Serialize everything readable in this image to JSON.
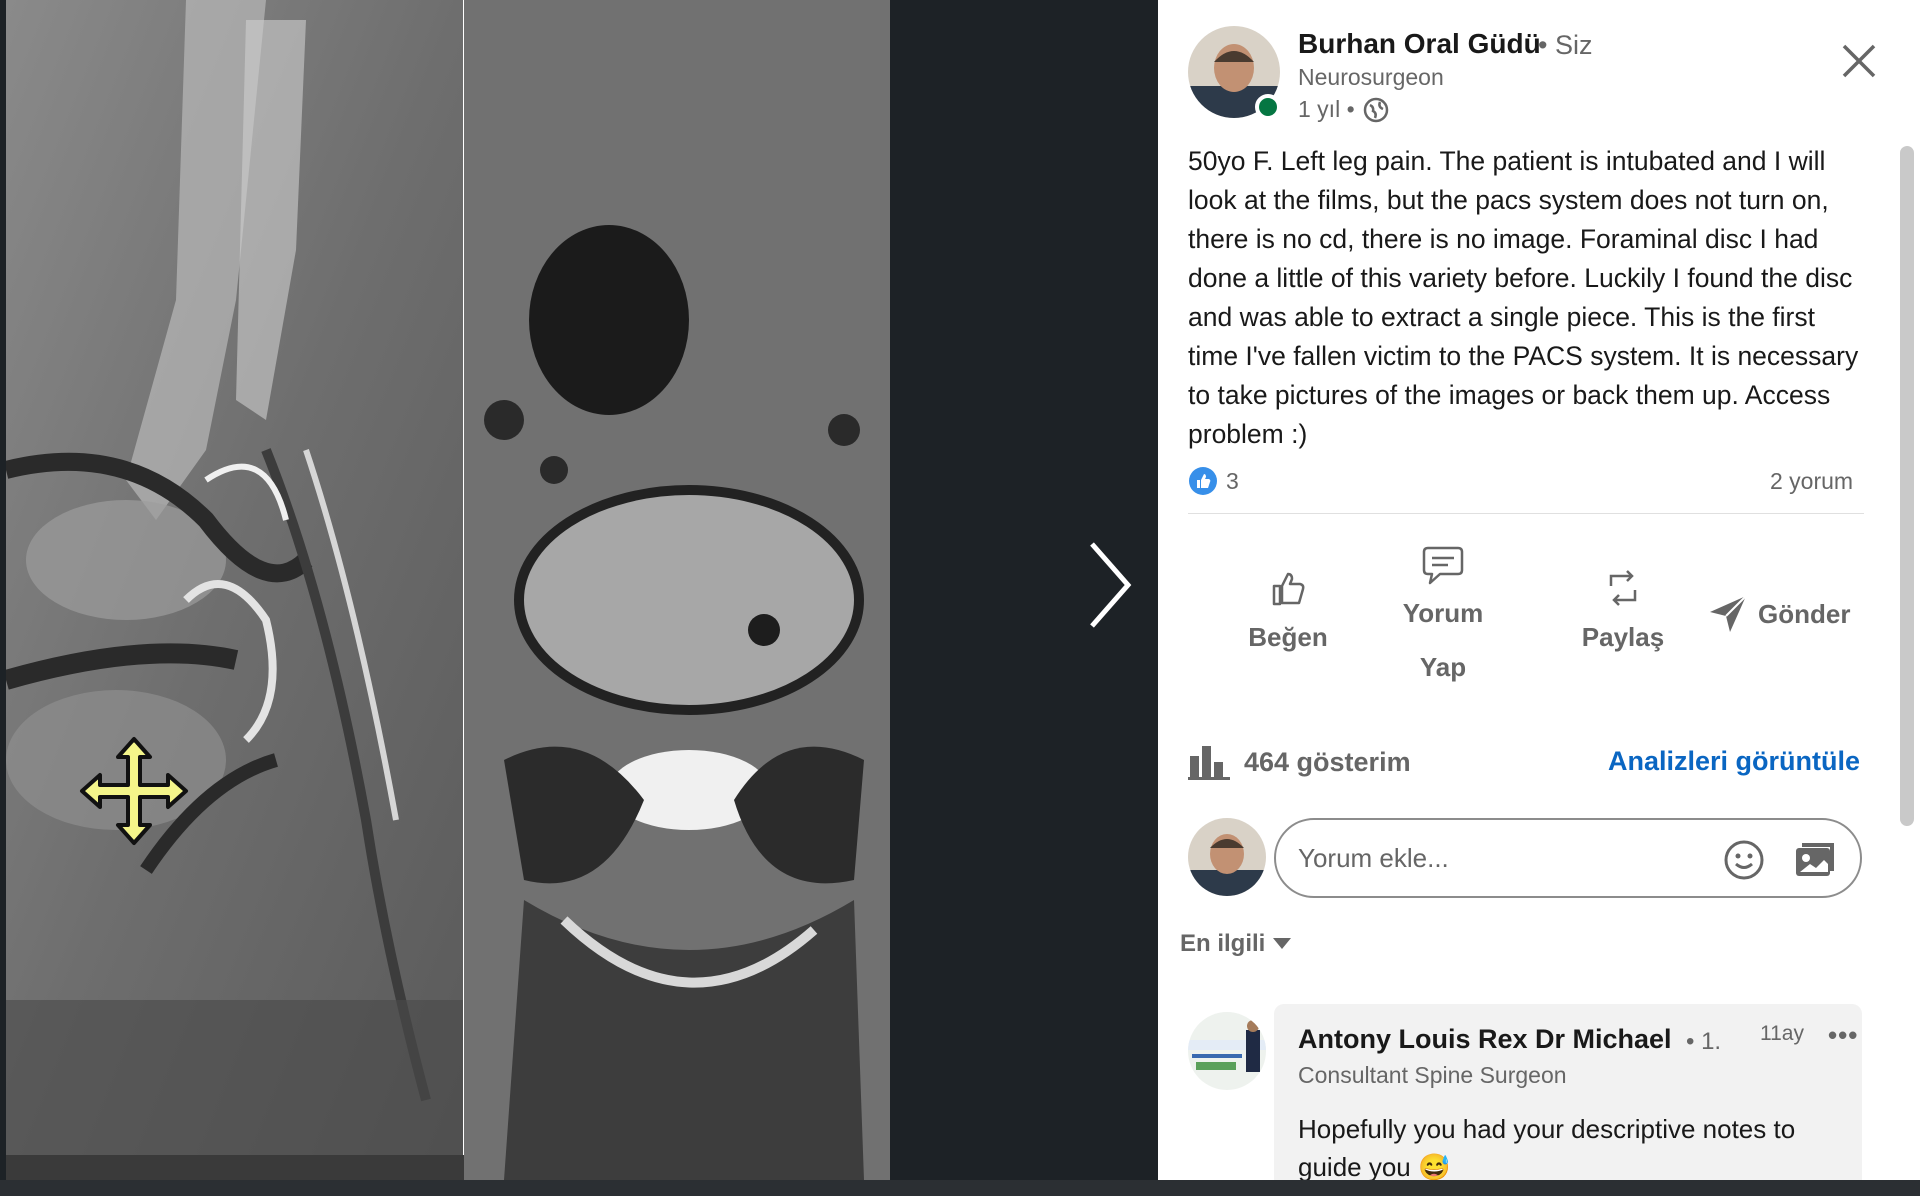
{
  "post": {
    "author_name": "Burhan Oral Güdü",
    "author_you": "• Siz",
    "author_title": "Neurosurgeon",
    "time": "1 yıl •",
    "text": "50yo F. Left leg pain. The patient is intubated and I will look at the films, but the pacs system does not turn on, there is no cd, there is no image. Foraminal disc I had done a little of this variety before. Luckily I found the disc and was able to extract a single piece. This is the first time I've fallen victim to the PACS system. It is necessary to take pictures of the images or back them up. Access problem :)",
    "reaction_count": "3",
    "comment_count": "2 yorum"
  },
  "actions": {
    "like": "Beğen",
    "comment_line1": "Yorum",
    "comment_line2": "Yap",
    "share": "Paylaş",
    "send": "Gönder"
  },
  "stats": {
    "impressions": "464 gösterim",
    "analytics_link": "Analizleri görüntüle"
  },
  "comment_input": {
    "placeholder": "Yorum ekle..."
  },
  "sort": {
    "label": "En ilgili"
  },
  "comments": [
    {
      "name": "Antony Louis Rex Dr Michael",
      "degree": "• 1.",
      "time": "11ay",
      "more": "•••",
      "title": "Consultant Spine Surgeon",
      "text": "Hopefully you had your descriptive notes to guide you 😅"
    }
  ],
  "colors": {
    "brand_blue": "#0a66c2",
    "online_green": "#057642",
    "viewer_bg": "#1d2226",
    "move_cursor_fill": "#f4f58a"
  },
  "icons": {
    "close": "close-icon",
    "next": "chevron-right-icon",
    "like": "thumbs-up-icon",
    "comment": "comment-bubble-icon",
    "share": "repost-icon",
    "send": "send-icon",
    "emoji": "emoji-icon",
    "image": "image-icon",
    "globe": "globe-icon",
    "chart": "bar-chart-icon"
  }
}
